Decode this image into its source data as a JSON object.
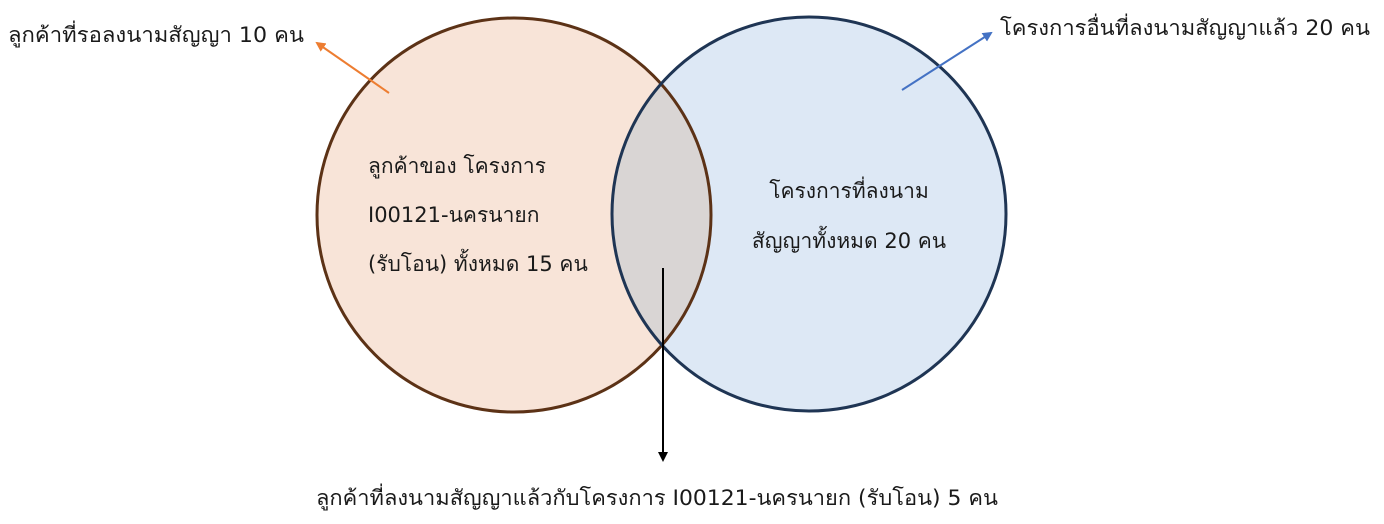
{
  "left_circle": {
    "lines": [
      "ลูกค้าของ โครงการ",
      "I00121-นครนายก",
      "(รับโอน) ทั้งหมด 15 คน"
    ],
    "fill": "#f8e4d8",
    "stroke": "#5c3216"
  },
  "right_circle": {
    "lines": [
      "โครงการที่ลงนาม",
      "สัญญาทั้งหมด 20 คน"
    ],
    "fill": "#dde8f5",
    "stroke": "#1f3554"
  },
  "overlap": {
    "fill": "#d9d5d4"
  },
  "callouts": {
    "top_left": {
      "text": "ลูกค้าที่รอลงนามสัญญา 10 คน",
      "color": "#ed7d31"
    },
    "top_right": {
      "text": "โครงการอื่นที่ลงนามสัญญาแล้ว 20 คน",
      "color": "#4472c4"
    },
    "bottom": {
      "text": "ลูกค้าที่ลงนามสัญญาแล้วกับโครงการ I00121-นครนายก (รับโอน) 5 คน",
      "color": "#000000"
    }
  }
}
